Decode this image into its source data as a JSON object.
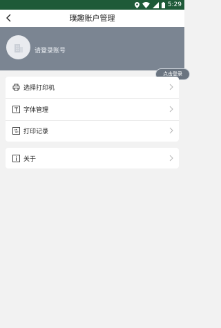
{
  "status_bar": {
    "time": "5:29",
    "icons": [
      "location-icon",
      "wifi-icon",
      "signal-icon",
      "battery-icon"
    ]
  },
  "header": {
    "title": "璞趣账户管理",
    "back_icon": "back-arrow-icon"
  },
  "account": {
    "login_prompt": "请登录账号",
    "login_button": "点击登录"
  },
  "menu_group_1": [
    {
      "label": "选择打印机",
      "icon": "printer-icon"
    },
    {
      "label": "字体管理",
      "icon": "font-icon"
    },
    {
      "label": "打印记录",
      "icon": "print-record-icon"
    }
  ],
  "menu_group_2": [
    {
      "label": "关于",
      "icon": "info-icon"
    }
  ],
  "colors": {
    "status_bar": "#1e5a38",
    "account_banner": "#7b8592",
    "background": "#f2f2f2"
  }
}
